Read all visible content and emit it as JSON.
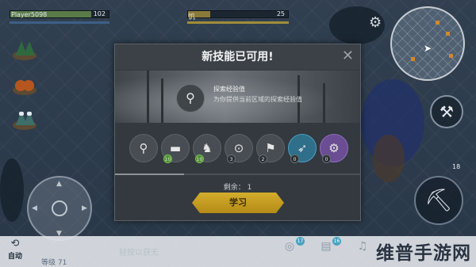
{
  "hud": {
    "player_name": "Player5098",
    "health_value": "102",
    "health_fraction": 0.82,
    "hunger_label": "饥",
    "hunger_value": "25",
    "hunger_fraction": 0.22,
    "settings_icon": "gear-icon"
  },
  "left_nav": {
    "items": [
      {
        "name": "pine-forest-icon"
      },
      {
        "name": "autumn-forest-icon"
      },
      {
        "name": "snow-forest-icon"
      }
    ]
  },
  "right_controls": {
    "craft_icon": "hammer-wrench-icon",
    "weapon_icon": "pickaxe-icon",
    "count": "18"
  },
  "dialog": {
    "title": "新技能已可用!",
    "close_icon": "close-icon",
    "featured_skill": {
      "icon": "explore-icon",
      "name": "探索经验值",
      "description": "为你提供当前区域的探索经验值"
    },
    "skills": [
      {
        "icon": "explore-icon",
        "glyph": "⚲",
        "count": "",
        "style": "normal"
      },
      {
        "icon": "log-icon",
        "glyph": "▬",
        "count": "10",
        "style": "normal",
        "count_style": "green"
      },
      {
        "icon": "dog-icon",
        "glyph": "♞",
        "count": "10",
        "style": "normal",
        "count_style": "green"
      },
      {
        "icon": "unlock-icon",
        "glyph": "🔓",
        "count": "3",
        "style": "normal"
      },
      {
        "icon": "walking-icon",
        "glyph": "🚶",
        "count": "2",
        "style": "normal"
      },
      {
        "icon": "running-icon",
        "glyph": "🏃",
        "count": "0",
        "style": "active"
      },
      {
        "icon": "motorcycle-icon",
        "glyph": "🏍",
        "count": "0",
        "style": "purple"
      }
    ],
    "remaining_label": "剩余：",
    "remaining_value": "1",
    "learn_button": "学习"
  },
  "bottom_bar": {
    "auto_label": "自动",
    "level_text": "等级 71",
    "hint_text": "轻按以获无",
    "slots": [
      {
        "icon": "coins-icon",
        "badge": "17"
      },
      {
        "icon": "map-icon",
        "badge": "16"
      },
      {
        "icon": "bell-icon",
        "badge": ""
      }
    ],
    "watermark": "维普手游网"
  },
  "colors": {
    "health": "#5a7a48",
    "hunger": "#8a7a3a",
    "learn_button": "#c9a124",
    "active_skill": "#2f6f8a"
  }
}
